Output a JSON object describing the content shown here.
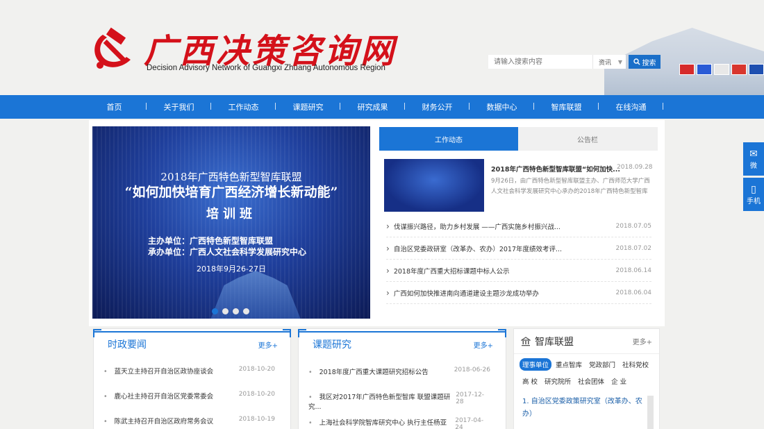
{
  "header": {
    "logo_text": "广西决策咨询网",
    "logo_subtitle": "Decision Advisory Network of Guangxi Zhuang Autonomous Region",
    "search_placeholder": "请输入搜索内容",
    "search_category": "资讯",
    "search_button": "搜索"
  },
  "nav": [
    "首页",
    "关于我们",
    "工作动态",
    "课题研究",
    "研究成果",
    "财务公开",
    "数据中心",
    "智库联盟",
    "在线沟通"
  ],
  "float": {
    "wechat": "微",
    "mobile": "手机"
  },
  "banner": {
    "line1": "2018年广西特色新型智库联盟",
    "line2": "“如何加快培育广西经济增长新动能”",
    "line3": "培训班",
    "line4": "主办单位：广西特色新型智库联盟",
    "line5": "承办单位：广西人文社会科学发展研究中心",
    "line6": "2018年9月26-27日"
  },
  "tabs": {
    "active": "工作动态",
    "other": "公告栏"
  },
  "feature": {
    "title": "2018年广西特色新型智库联盟“如何加快...",
    "date": "2018.09.28",
    "desc": "9月26日，由广西特色新型智库联盟主办、广西师范大学广西人文社会科学发展研究中心承办的2018年广西特色新型智库"
  },
  "news": [
    {
      "title": "伐谋振兴路径，助力乡村发展 ——广西实施乡村振兴战...",
      "date": "2018.07.05"
    },
    {
      "title": "自治区党委政研室（改革办、农办）2017年度绩效考评...",
      "date": "2018.07.02"
    },
    {
      "title": "2018年度广西重大招标课题中标人公示",
      "date": "2018.06.14"
    },
    {
      "title": "广西如何加快推进南向通道建设主题沙龙成功举办",
      "date": "2018.06.04"
    }
  ],
  "politics": {
    "title": "时政要闻",
    "more": "更多+",
    "items": [
      {
        "title": "蓝天立主持召开自治区政协座谈会",
        "date": "2018-10-20"
      },
      {
        "title": "鹿心社主持召开自治区党委常委会",
        "date": "2018-10-20"
      },
      {
        "title": "陈武主持召开自治区政府常务会议",
        "date": "2018-10-19"
      }
    ]
  },
  "research": {
    "title": "课题研究",
    "more": "更多+",
    "items": [
      {
        "title": "2018年度广西重大课题研究招标公告",
        "date": "2018-06-26"
      },
      {
        "title": "我区对2017年广西特色新型智库 联盟课题研究...",
        "date": "2017-12-28"
      },
      {
        "title": "上海社会科学院智库研究中心 执行主任杨亚琴...",
        "date": "2017-04-24"
      }
    ]
  },
  "alliance": {
    "title": "智库联盟",
    "more": "更多+",
    "tabs": [
      "理事单位",
      "重点智库",
      "党政部门",
      "社科党校",
      "高 校",
      "研究院所",
      "社会团体",
      "企 业"
    ],
    "first_item": "1. 自治区党委政策研究室（改革办、农办）"
  }
}
